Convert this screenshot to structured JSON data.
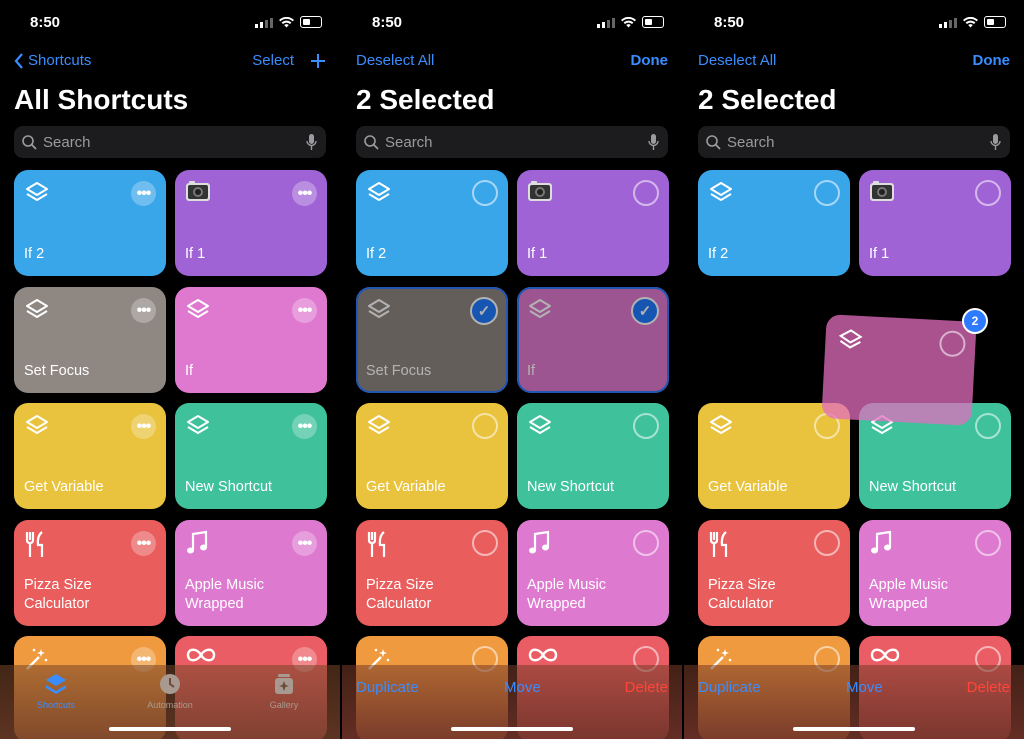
{
  "status": {
    "time": "8:50"
  },
  "panels": [
    {
      "nav_left": "Shortcuts",
      "nav_right": "Select",
      "title": "All Shortcuts",
      "search_placeholder": "Search",
      "tiles": [
        {
          "label": "If 2",
          "color": "#3aa6ea",
          "icon": "layers-icon"
        },
        {
          "label": "If 1",
          "color": "#a063d6",
          "icon": "camera-icon"
        },
        {
          "label": "Set Focus",
          "color": "#8f8782",
          "icon": "layers-icon"
        },
        {
          "label": "If",
          "color": "#df79cf",
          "icon": "layers-icon"
        },
        {
          "label": "Get Variable",
          "color": "#e9c33d",
          "icon": "layers-icon"
        },
        {
          "label": "New Shortcut",
          "color": "#3fc29c",
          "icon": "layers-icon"
        },
        {
          "label": "Pizza Size\nCalculator",
          "color": "#e95d5d",
          "icon": "utensils-icon"
        },
        {
          "label": "Apple Music\nWrapped",
          "color": "#de79d0",
          "icon": "music-note-icon"
        },
        {
          "label": "",
          "color": "#ef9a3e",
          "icon": "magic-wand-icon"
        },
        {
          "label": "",
          "color": "#ea5d64",
          "icon": "infinity-icon"
        }
      ],
      "tabs": [
        {
          "label": "Shortcuts",
          "icon": "stack-icon"
        },
        {
          "label": "Automation",
          "icon": "clock-icon"
        },
        {
          "label": "Gallery",
          "icon": "gallery-icon"
        }
      ]
    },
    {
      "nav_left": "Deselect All",
      "nav_right": "Done",
      "title": "2 Selected",
      "search_placeholder": "Search",
      "actions": {
        "duplicate": "Duplicate",
        "move": "Move",
        "delete": "Delete"
      }
    },
    {
      "nav_left": "Deselect All",
      "nav_right": "Done",
      "title": "2 Selected",
      "search_placeholder": "Search",
      "drag_badge": "2",
      "actions": {
        "duplicate": "Duplicate",
        "move": "Move",
        "delete": "Delete"
      }
    }
  ],
  "colors": {
    "accent": "#3a8dff",
    "danger": "#ff453a"
  }
}
